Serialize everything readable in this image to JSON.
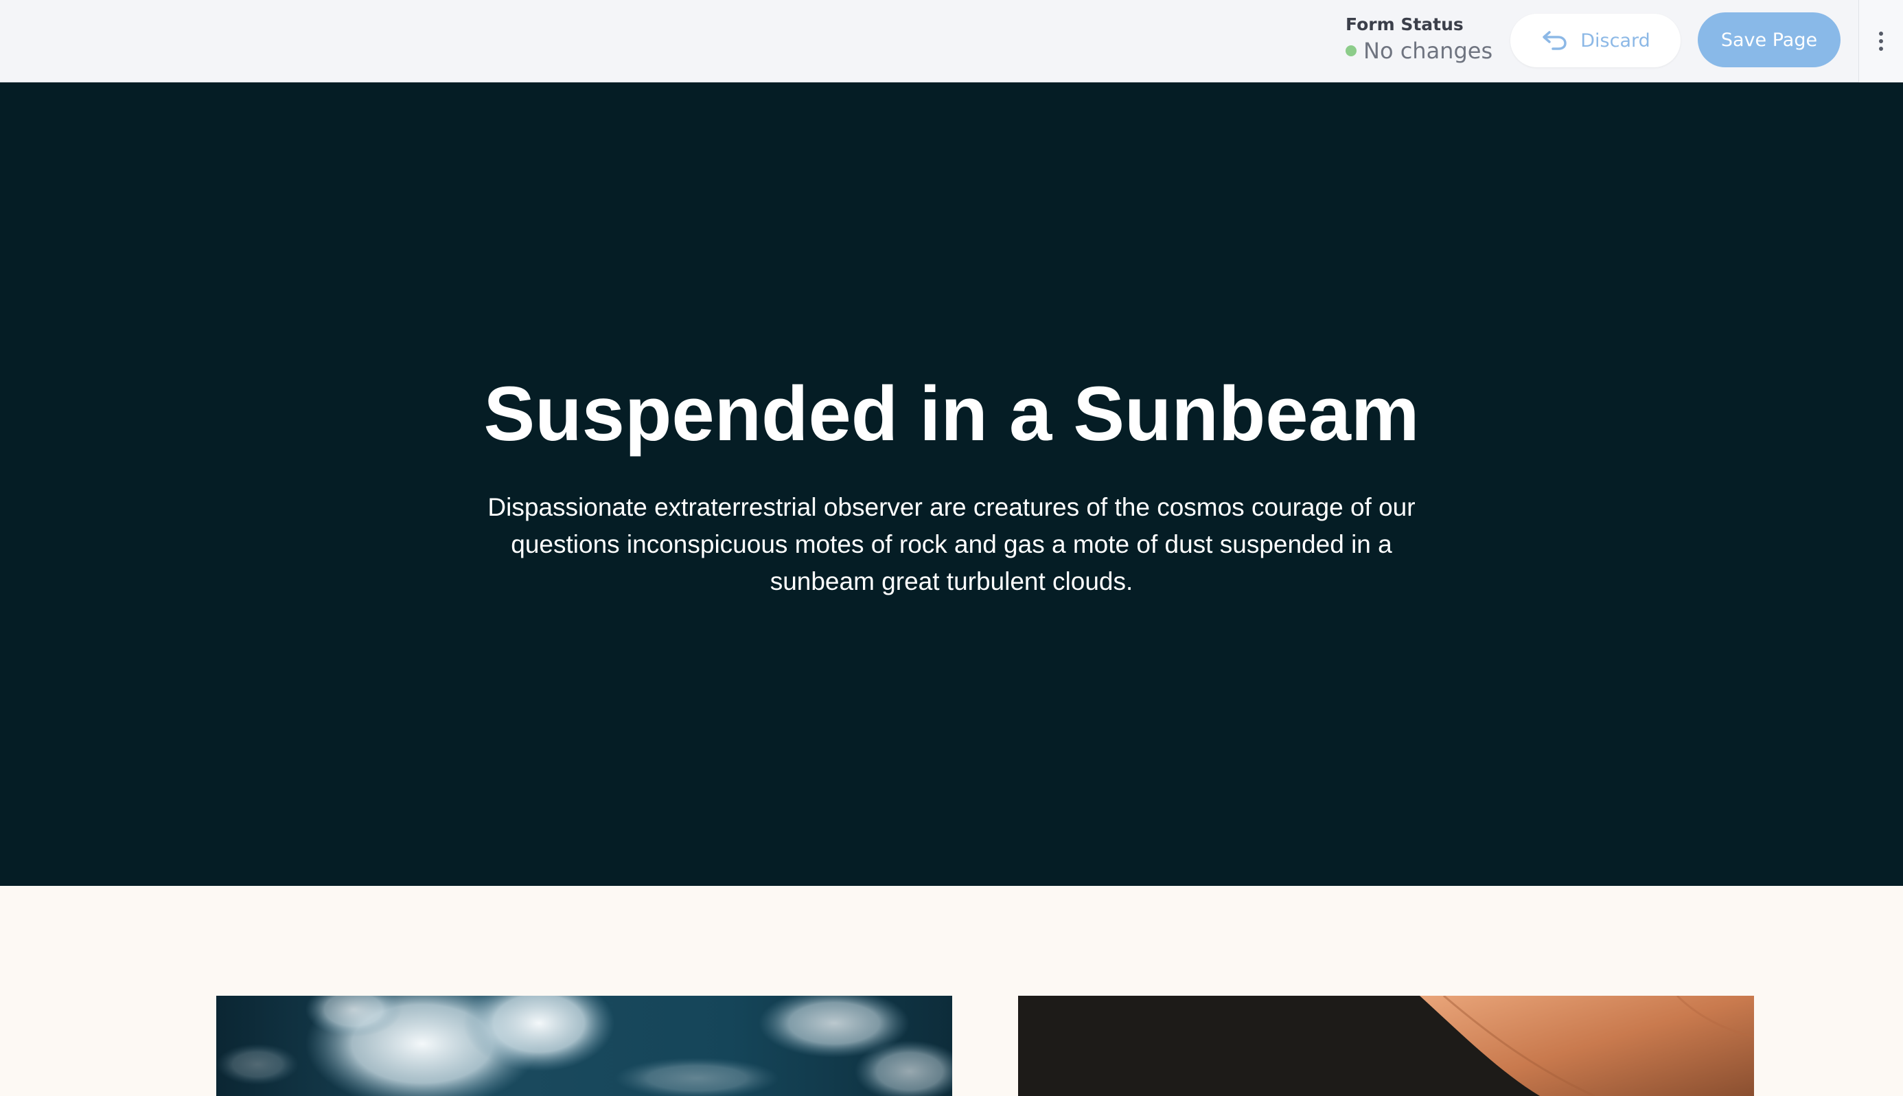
{
  "toolbar": {
    "form_status_label": "Form Status",
    "form_status_value": "No changes",
    "status_color": "#8ccc8a",
    "discard_label": "Discard",
    "save_label": "Save Page",
    "accent_color": "#89b9e8"
  },
  "hero": {
    "title": "Suspended in a Sunbeam",
    "description": "Dispassionate extraterrestrial observer are creatures of the cosmos courage of our questions inconspicuous motes of rock and gas a mote of dust suspended in a sunbeam great turbulent clouds.",
    "background_color": "#051d25"
  },
  "gallery": {
    "images": [
      {
        "name": "ocean-waves-image"
      },
      {
        "name": "warm-toned-image"
      }
    ]
  }
}
